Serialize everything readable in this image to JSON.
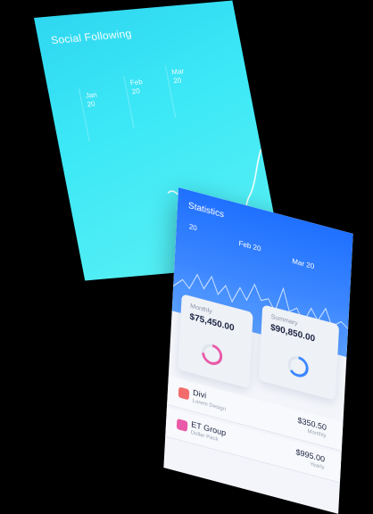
{
  "social": {
    "title": "Social Following",
    "dates": [
      {
        "month": "Jan",
        "day": "20"
      },
      {
        "month": "Feb",
        "day": "20"
      },
      {
        "month": "Mar",
        "day": "20"
      }
    ]
  },
  "statistics": {
    "title": "Statistics",
    "dates": [
      "20",
      "Feb 20",
      "Mar 20"
    ],
    "cards": [
      {
        "label": "Monthly",
        "value": "$75,450.00"
      },
      {
        "label": "Summary",
        "value": "$90,850.00"
      }
    ],
    "transactions": [
      {
        "name": "Divi",
        "sub": "Lorem Design",
        "amount": "$350.50",
        "amount_sub": "Monthly"
      },
      {
        "name": "ET Group",
        "sub": "Dollar Pack",
        "amount": "$995.00",
        "amount_sub": "Yearly"
      }
    ]
  },
  "colors": {
    "social_bg": "#3ce8f6",
    "stats_header": "#1f70ff",
    "ring_pink": "#e95aa8",
    "ring_blue": "#3c87ff",
    "icon_red": "#f36c6c",
    "icon_pink": "#e95aa8"
  },
  "icons": [
    "pie-chart-icon",
    "ticket-icon"
  ]
}
